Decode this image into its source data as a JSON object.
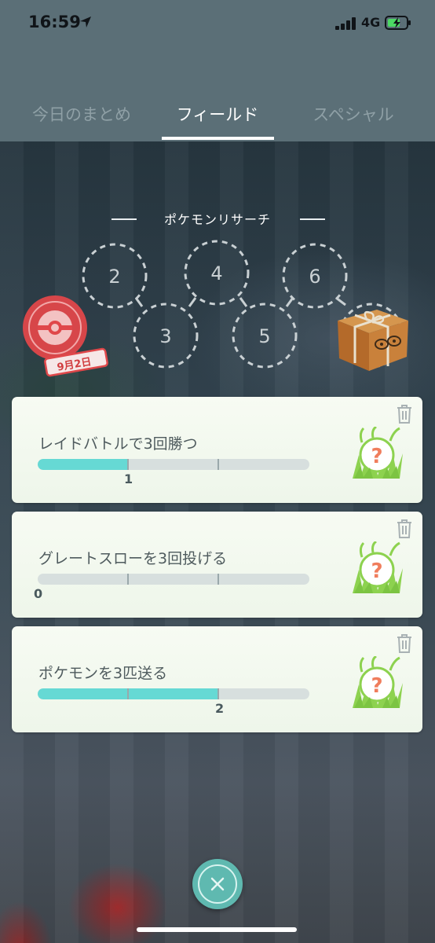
{
  "status_bar": {
    "time": "16:59",
    "network": "4G"
  },
  "tabs": [
    {
      "label": "今日のまとめ",
      "selected": false
    },
    {
      "label": "フィールド",
      "selected": true
    },
    {
      "label": "スペシャル",
      "selected": false
    }
  ],
  "research": {
    "title": "ポケモンリサーチ",
    "stamps": [
      "2",
      "3",
      "4",
      "5",
      "6"
    ],
    "first_stamp_date": "9月2日"
  },
  "tasks": [
    {
      "title": "レイドバトルで3回勝つ",
      "progress": 1,
      "goal": 3,
      "progress_label": "1"
    },
    {
      "title": "グレートスローを3回投げる",
      "progress": 0,
      "goal": 3,
      "progress_label": "0"
    },
    {
      "title": "ポケモンを3匹送る",
      "progress": 2,
      "goal": 3,
      "progress_label": "2"
    }
  ],
  "colors": {
    "accent": "#66d9d4",
    "header": "#5b6f77",
    "stamp": "#e0474a"
  }
}
